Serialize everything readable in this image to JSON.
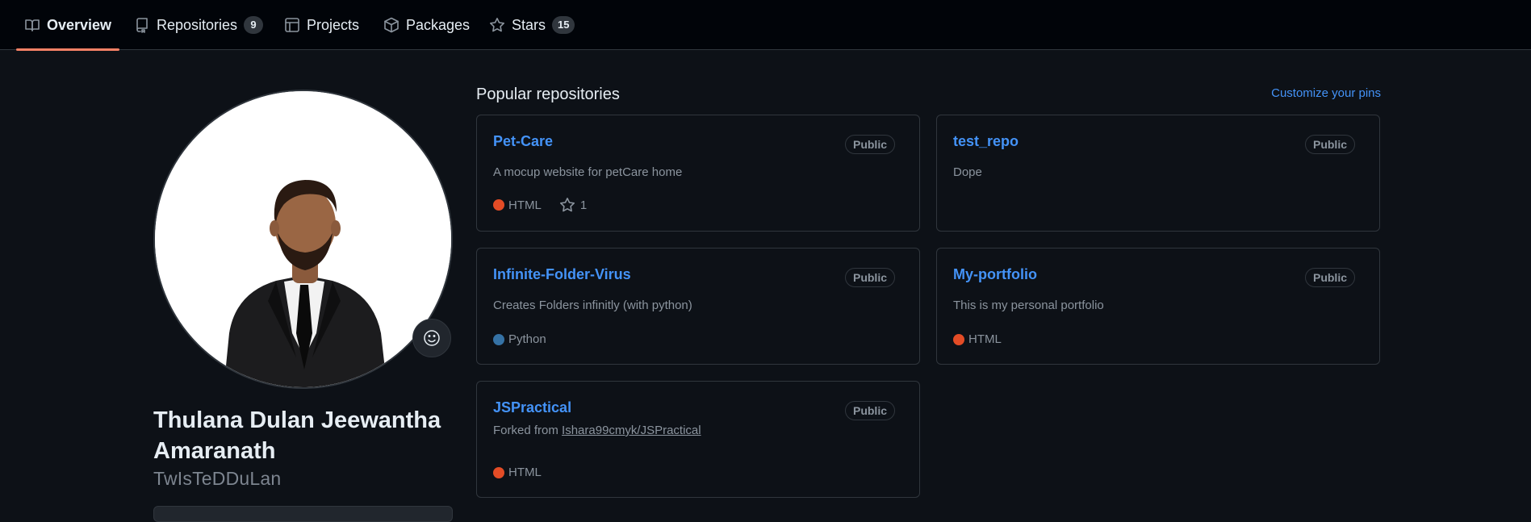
{
  "nav": {
    "tabs": [
      {
        "label": "Overview",
        "icon": "book-icon"
      },
      {
        "label": "Repositories",
        "icon": "repo-icon",
        "count": "9"
      },
      {
        "label": "Projects",
        "icon": "table-icon"
      },
      {
        "label": "Packages",
        "icon": "package-icon"
      },
      {
        "label": "Stars",
        "icon": "star-icon",
        "count": "15"
      }
    ],
    "active_underline_color": "#f78166"
  },
  "profile": {
    "full_name": "Thulana Dulan Jeewantha Amaranath",
    "username": "TwIsTeDDuLan",
    "avatar": "profile-photo-man-in-black-suit",
    "status_icon": "smiley-icon"
  },
  "pinned": {
    "title": "Popular repositories",
    "customize_label": "Customize your pins",
    "repos": [
      {
        "name": "Pet-Care",
        "visibility": "Public",
        "description": "A mocup website for petCare home",
        "language": "HTML",
        "language_color": "#e34c26",
        "stars": "1"
      },
      {
        "name": "test_repo",
        "visibility": "Public",
        "description": "Dope"
      },
      {
        "name": "Infinite-Folder-Virus",
        "visibility": "Public",
        "description": "Creates Folders infinitly (with python)",
        "language": "Python",
        "language_color": "#3572A5"
      },
      {
        "name": "My-portfolio",
        "visibility": "Public",
        "description": "This is my personal portfolio",
        "language": "HTML",
        "language_color": "#e34c26"
      },
      {
        "name": "JSPractical",
        "visibility": "Public",
        "forked_prefix": "Forked from ",
        "forked_from": "Ishara99cmyk/JSPractical",
        "language": "HTML",
        "language_color": "#e34c26"
      }
    ]
  },
  "colors": {
    "background": "#0d1117",
    "nav_background": "#010409",
    "link": "#4493f8",
    "muted_text": "#8b949e"
  }
}
